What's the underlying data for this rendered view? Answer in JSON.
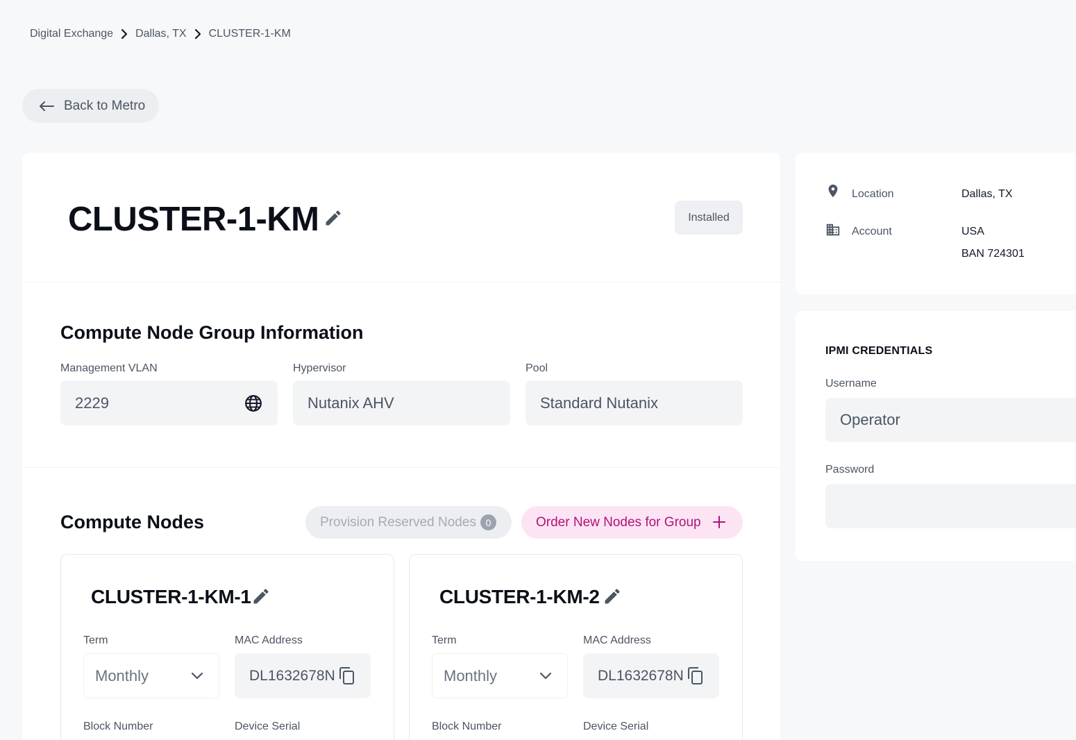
{
  "breadcrumb": {
    "items": [
      "Digital Exchange",
      "Dallas, TX",
      "CLUSTER-1-KM"
    ]
  },
  "back_button": {
    "label": "Back to Metro",
    "icon": "arrow-left-icon"
  },
  "cluster": {
    "title": "CLUSTER-1-KM",
    "status": "Installed"
  },
  "node_group": {
    "title": "Compute Node Group Information",
    "management_vlan": {
      "label": "Management VLAN",
      "value": "2229",
      "icon": "globe-icon"
    },
    "hypervisor": {
      "label": "Hypervisor",
      "value": "Nutanix AHV"
    },
    "pool": {
      "label": "Pool",
      "value": "Standard Nutanix"
    }
  },
  "compute_nodes": {
    "title": "Compute Nodes",
    "provision_label": "Provision Reserved Nodes",
    "provision_count": "0",
    "order_label": "Order New Nodes for Group",
    "nodes": [
      {
        "name": "CLUSTER-1-KM-1",
        "term_label": "Term",
        "term_value": "Monthly",
        "mac_label": "MAC Address",
        "mac_value": "DL1632678N",
        "block_label": "Block Number",
        "serial_label": "Device Serial"
      },
      {
        "name": "CLUSTER-1-KM-2",
        "term_label": "Term",
        "term_value": "Monthly",
        "mac_label": "MAC Address",
        "mac_value": "DL1632678N",
        "block_label": "Block Number",
        "serial_label": "Device Serial"
      }
    ]
  },
  "details": {
    "location_label": "Location",
    "location_value": "Dallas, TX",
    "account_label": "Account",
    "account_value": "USA",
    "account_ban": "BAN 724301"
  },
  "ipmi": {
    "title": "IPMI CREDENTIALS",
    "username_label": "Username",
    "username_value": "Operator",
    "password_label": "Password",
    "password_value": ""
  },
  "colors": {
    "accent": "#b0127a",
    "accent_bg": "#fde4f4",
    "page_bg": "#f7f8fa"
  }
}
